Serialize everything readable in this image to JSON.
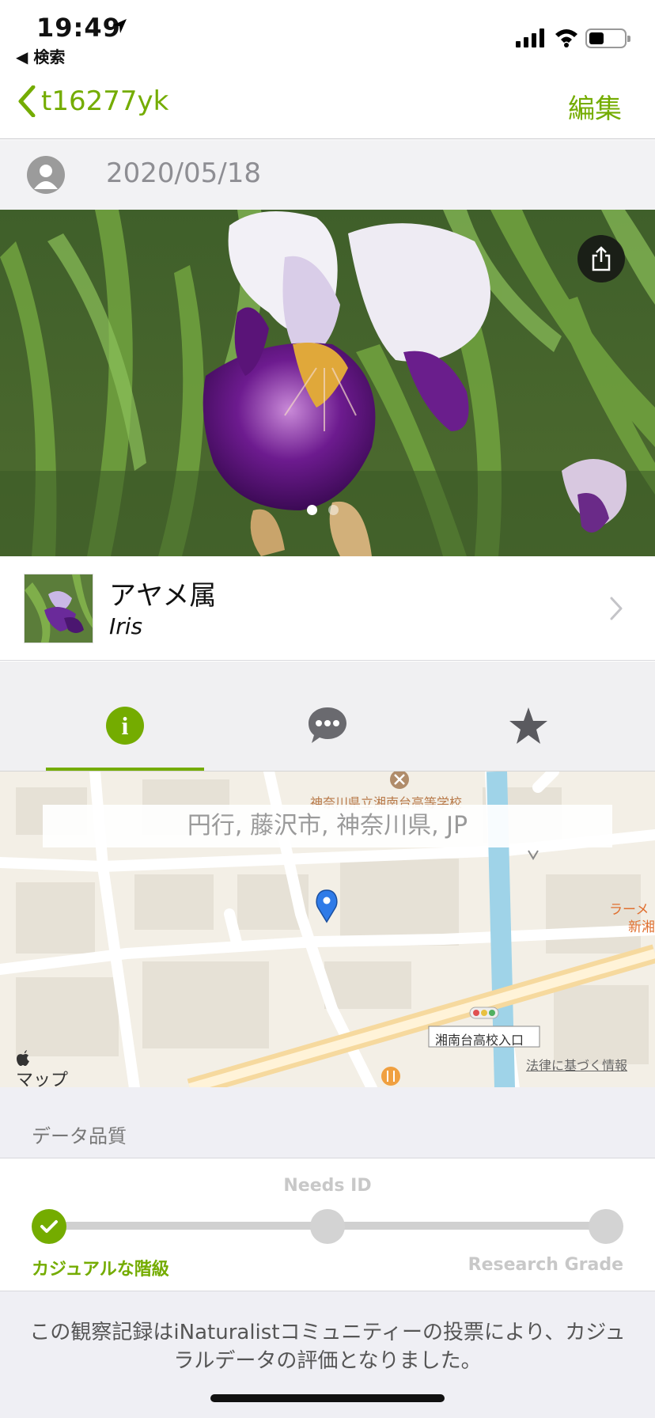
{
  "status_bar": {
    "time": "19:49",
    "back_app": "◀ 検索"
  },
  "nav": {
    "back_label": "t16277yk",
    "edit_label": "編集"
  },
  "observation": {
    "date": "2020/05/18",
    "photo_count": 2,
    "active_photo_index": 0
  },
  "taxon": {
    "common_name": "アヤメ属",
    "scientific_name": "Iris"
  },
  "tabs": [
    {
      "name": "info",
      "icon": "info-icon",
      "active": true
    },
    {
      "name": "comments",
      "icon": "comment-icon",
      "active": false
    },
    {
      "name": "favorites",
      "icon": "star-icon",
      "active": false
    }
  ],
  "map": {
    "place_guess": "円行, 藤沢市, 神奈川県, JP",
    "labels": {
      "school": "神奈川県立湘南台高等学校",
      "ramen": "ラーメ",
      "shin": "新湘",
      "bus_stop": "湘南台高校入口"
    },
    "maps_logo": "マップ",
    "legal": "法律に基づく情報"
  },
  "data_quality": {
    "header": "データ品質",
    "needs_id": "Needs ID",
    "casual": "カジュアルな階級",
    "research_grade": "Research Grade",
    "current_level": "casual",
    "description": "この観察記録はiNaturalistコミュニティーの投票により、カジュラルデータの評価となりました。"
  },
  "colors": {
    "accent": "#74ac00",
    "muted": "#8e8e93",
    "background_gray": "#efeff4"
  }
}
